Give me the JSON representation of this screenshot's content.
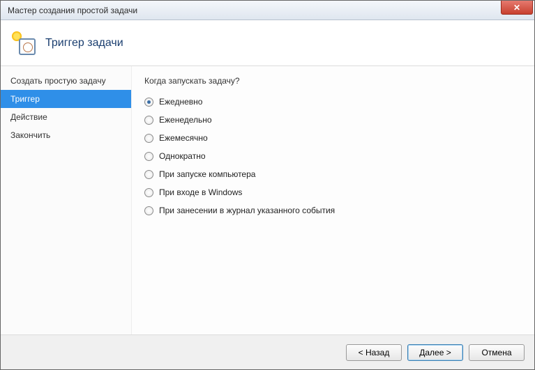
{
  "window": {
    "title": "Мастер создания простой задачи"
  },
  "header": {
    "title": "Триггер задачи"
  },
  "sidebar": {
    "items": [
      {
        "label": "Создать простую задачу",
        "active": false
      },
      {
        "label": "Триггер",
        "active": true
      },
      {
        "label": "Действие",
        "active": false
      },
      {
        "label": "Закончить",
        "active": false
      }
    ]
  },
  "content": {
    "question": "Когда запускать задачу?",
    "options": [
      {
        "label": "Ежедневно",
        "checked": true
      },
      {
        "label": "Еженедельно",
        "checked": false
      },
      {
        "label": "Ежемесячно",
        "checked": false
      },
      {
        "label": "Однократно",
        "checked": false
      },
      {
        "label": "При запуске компьютера",
        "checked": false
      },
      {
        "label": "При входе в Windows",
        "checked": false
      },
      {
        "label": "При занесении в журнал указанного события",
        "checked": false
      }
    ]
  },
  "footer": {
    "back": "< Назад",
    "next": "Далее >",
    "cancel": "Отмена"
  }
}
